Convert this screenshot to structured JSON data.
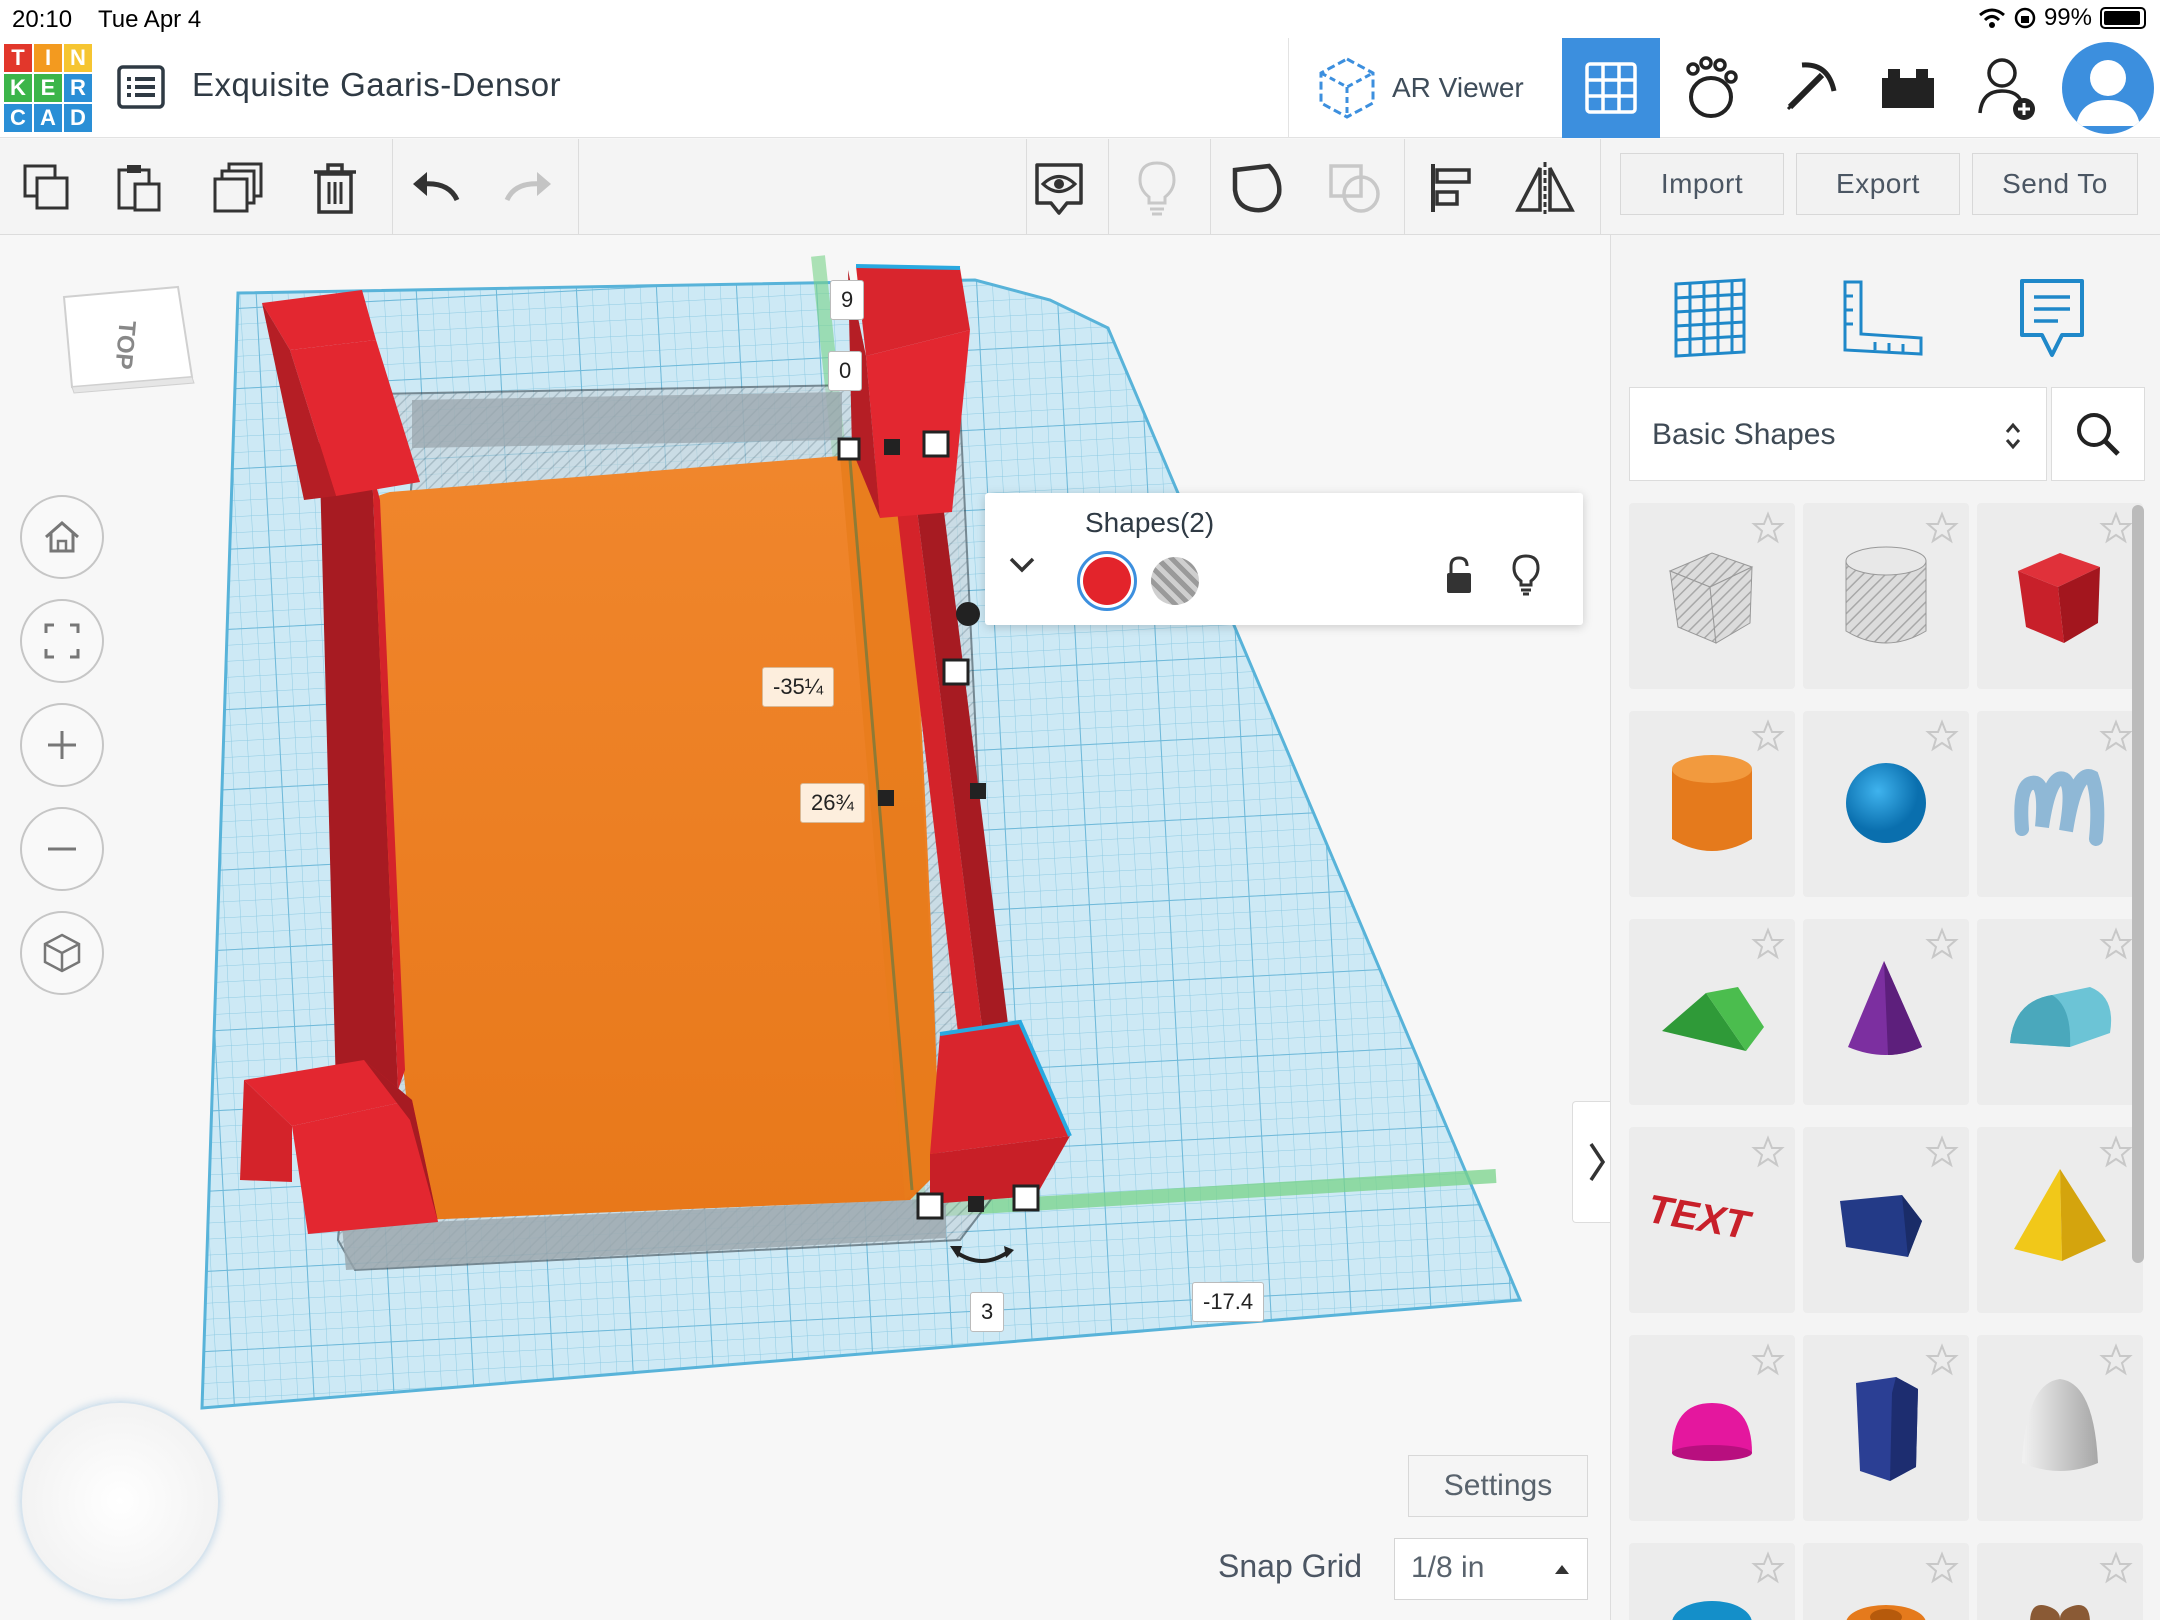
{
  "status": {
    "time": "20:10",
    "date": "Tue Apr 4",
    "battery": "99%"
  },
  "logo": {
    "letters": [
      "T",
      "I",
      "N",
      "K",
      "E",
      "R",
      "C",
      "A",
      "D"
    ]
  },
  "header": {
    "project_title": "Exquisite Gaaris-Densor",
    "ar_viewer_label": "AR Viewer"
  },
  "toolbar": {
    "import_label": "Import",
    "export_label": "Export",
    "send_to_label": "Send To"
  },
  "workplane": {
    "viewcube_face": "TOP",
    "dimensions": {
      "height_top": "9",
      "elevation": "0",
      "length": "-35¼",
      "width": "26¾",
      "rotation_value": "3",
      "position": "-17.4"
    }
  },
  "shape_popup": {
    "title": "Shapes(2)",
    "solid_color": "#e3242b",
    "hole_label": "hole"
  },
  "bottom": {
    "settings_label": "Settings",
    "snap_grid_label": "Snap Grid",
    "snap_grid_value": "1/8 in"
  },
  "library": {
    "selected": "Basic Shapes",
    "shapes": [
      "box-hole-icon",
      "cylinder-hole-icon",
      "box-icon",
      "cylinder-icon",
      "sphere-icon",
      "scribble-icon",
      "roof-icon",
      "cone-icon",
      "round-roof-icon",
      "text-icon",
      "polygon-icon",
      "pyramid-icon",
      "half-sphere-icon",
      "hexagonal-prism-icon",
      "paraboloid-icon",
      "torus-icon",
      "tube-icon",
      "heart-icon"
    ],
    "text_shape_label": "TEXT"
  },
  "colors": {
    "accent": "#3c8fde",
    "red": "#e3242b",
    "orange": "#ee7d1e",
    "grid": "#bfe6f5"
  }
}
